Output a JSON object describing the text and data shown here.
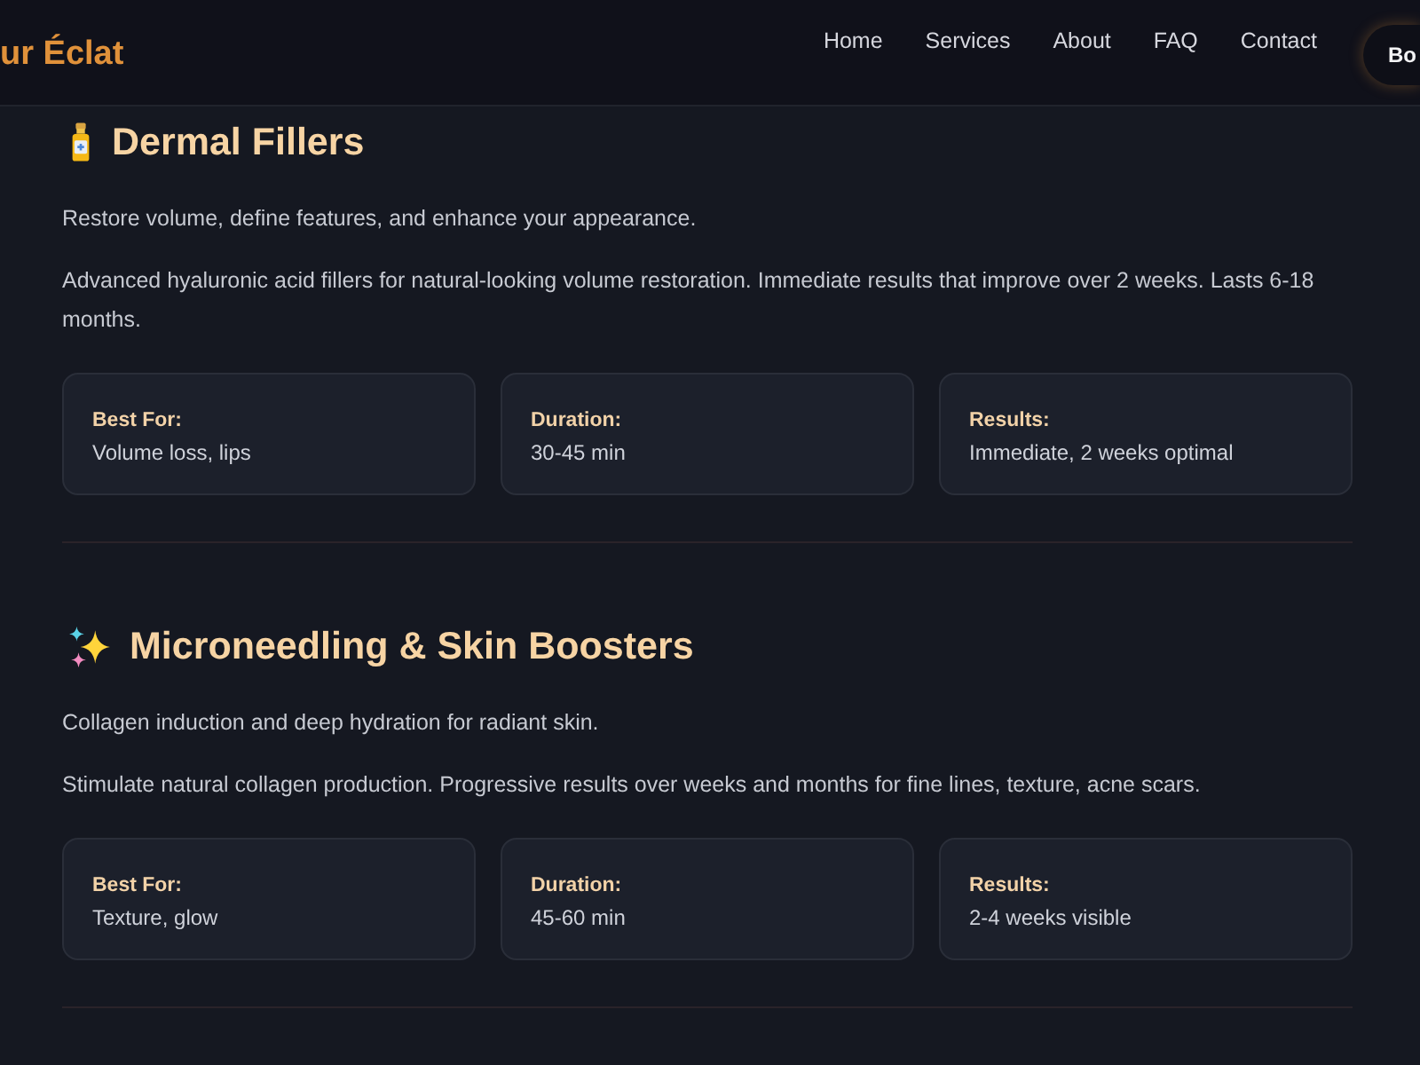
{
  "header": {
    "logo": "ur Éclat",
    "nav": [
      "Home",
      "Services",
      "About",
      "FAQ",
      "Contact"
    ],
    "button": "Bo"
  },
  "sections": [
    {
      "title": "Dermal Fillers",
      "tagline": "Restore volume, define features, and enhance your appearance.",
      "description": "Advanced hyaluronic acid fillers for natural-looking volume restoration. Immediate results that improve over 2 weeks. Lasts 6-18 months.",
      "facts": [
        {
          "label": "Best For:",
          "value": "Volume loss, lips"
        },
        {
          "label": "Duration:",
          "value": "30-45 min"
        },
        {
          "label": "Results:",
          "value": "Immediate, 2 weeks optimal"
        }
      ]
    },
    {
      "title": "Microneedling & Skin Boosters",
      "tagline": "Collagen induction and deep hydration for radiant skin.",
      "description": "Stimulate natural collagen production. Progressive results over weeks and months for fine lines, texture, acne scars.",
      "facts": [
        {
          "label": "Best For:",
          "value": "Texture, glow"
        },
        {
          "label": "Duration:",
          "value": "45-60 min"
        },
        {
          "label": "Results:",
          "value": "2-4 weeks visible"
        }
      ]
    }
  ]
}
